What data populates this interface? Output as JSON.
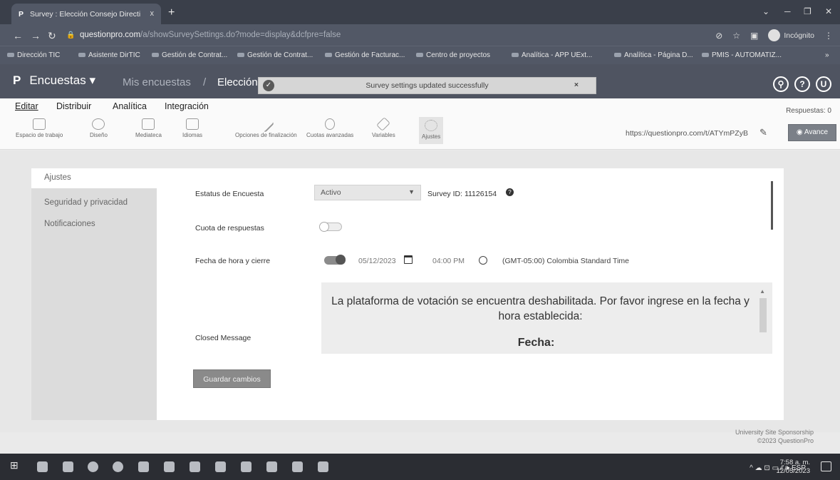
{
  "browser": {
    "tab_title": "Survey : Elección Consejo Directi",
    "tab_favicon": "P",
    "tab_close": "x",
    "new_tab": "+",
    "url_main": "questionpro.com",
    "url_rest": "/a/showSurveySettings.do?mode=display&dcfpre=false",
    "incognito_label": "Incógnito",
    "bookmarks": [
      "Dirección TIC",
      "Asistente DirTIC",
      "Gestión de Contrat...",
      "Gestión de Contrat...",
      "Gestión de Facturac...",
      "Centro de proyectos",
      "Analítica - APP UExt...",
      "Analítica - Página D...",
      "PMIS - AUTOMATIZ..."
    ]
  },
  "header": {
    "logo": "P",
    "product": "Encuestas ▾",
    "crumb1": "Mis encuestas",
    "crumb_sep": "/",
    "crumb2": "Elección",
    "toast": "Survey settings updated successfully",
    "toast_close": "×",
    "icons": [
      "search-icon",
      "help-icon",
      "user-icon"
    ],
    "user_initial": "U"
  },
  "menu": {
    "items": [
      "Editar",
      "Distribuir",
      "Analítica",
      "Integración"
    ],
    "active": "Editar",
    "responses": "Respuestas: 0"
  },
  "toolbar": {
    "tools": [
      "Espacio de trabajo",
      "Diseño",
      "Mediateca",
      "Idiomas",
      "Opciones de finalización",
      "Cuotas avanzadas",
      "Variables",
      "Ajustes"
    ],
    "selected": "Ajustes",
    "short_link": "https://questionpro.com/t/ATYmPZyB",
    "preview_label": "◉ Avance"
  },
  "sidebar": {
    "items": [
      "Ajustes",
      "Seguridad y privacidad",
      "Notificaciones"
    ],
    "selected": "Ajustes"
  },
  "settings": {
    "status_label": "Estatus de Encuesta",
    "status_value": "Activo",
    "survey_id_label": "Survey ID:",
    "survey_id_value": "11126154",
    "quota_label": "Cuota de respuestas",
    "quota_enabled": false,
    "close_label": "Fecha de hora y cierre",
    "close_enabled": true,
    "close_date": "05/12/2023",
    "close_time": "04:00 PM",
    "timezone": "(GMT-05:00) Colombia Standard Time",
    "closed_message_label": "Closed Message",
    "closed_message_text": "La plataforma de votación se encuentra deshabilitada. Por favor ingrese en la fecha y hora establecida:",
    "closed_message_heading": "Fecha:",
    "save_label": "Guardar cambios"
  },
  "footer": {
    "line1": "University Site Sponsorship",
    "line2": "©2023 QuestionPro"
  },
  "taskbar": {
    "tray_text": "^ ☁ ⊡ ▭ ⁄⁄ 🕪 ESP",
    "time": "7:58 a. m.",
    "date": "12/05/2023"
  }
}
